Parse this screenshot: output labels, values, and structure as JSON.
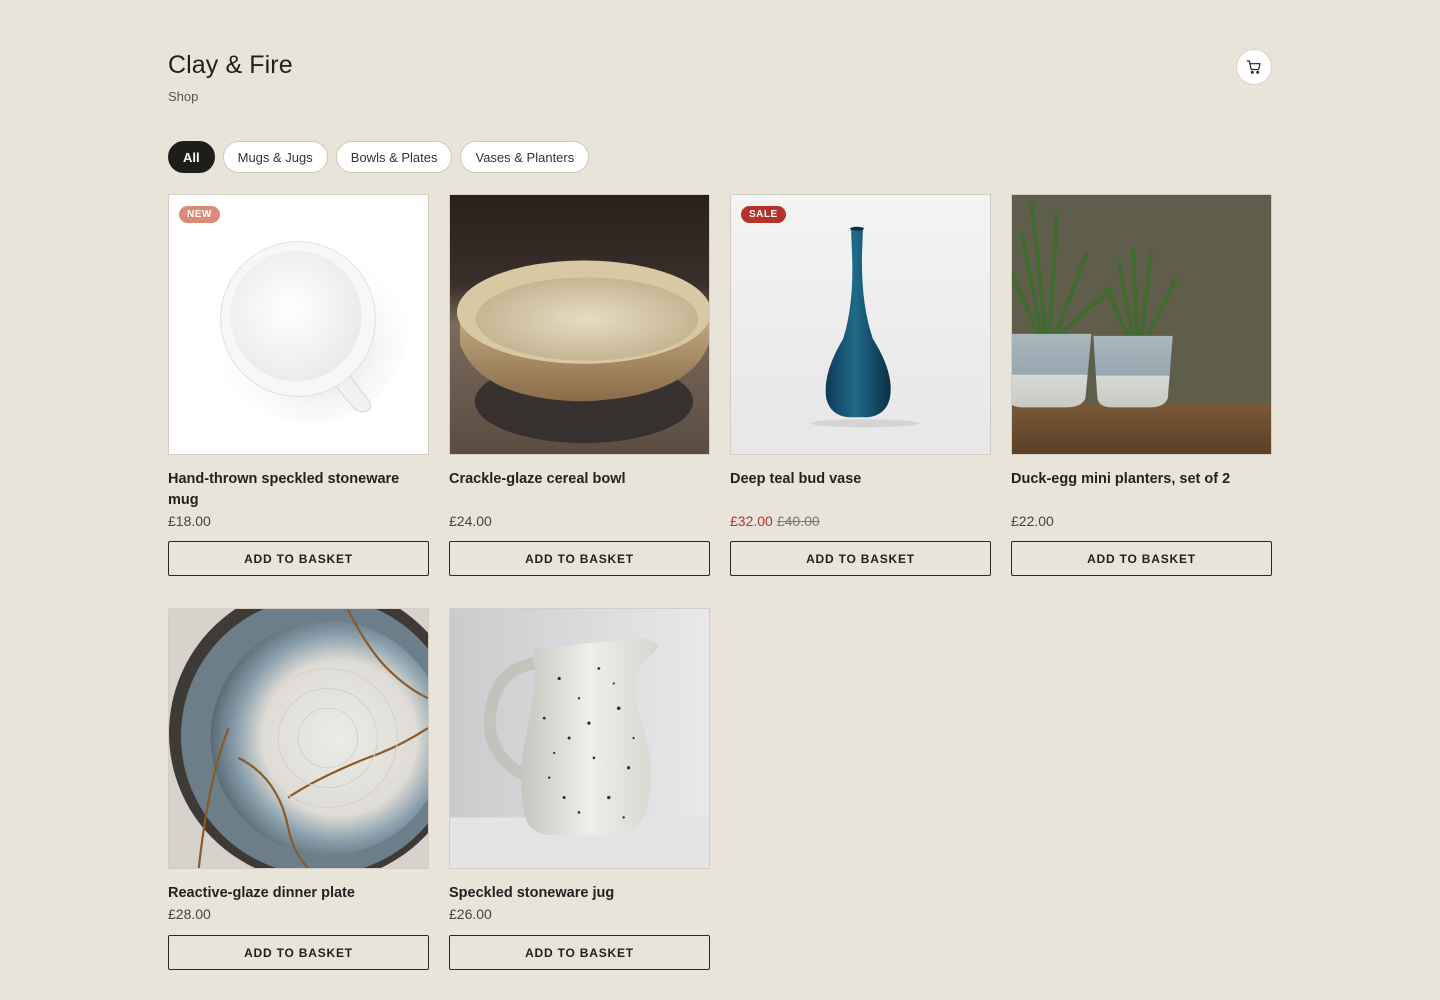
{
  "header": {
    "brand": "Clay & Fire",
    "subtitle": "Shop",
    "cart_icon": "cart-icon"
  },
  "filters": [
    "All",
    "Mugs & Jugs",
    "Bowls & Plates",
    "Vases & Planters"
  ],
  "active_filter": "All",
  "add_label": "ADD TO BASKET",
  "colors": {
    "background": "#e8e4da",
    "sale_red": "#b5322a",
    "new_badge": "#d98b78",
    "dark": "#1f1d1a"
  },
  "products": [
    {
      "name": "Hand-thrown speckled stoneware mug",
      "price": "£18.00",
      "badge": "NEW",
      "image": "white-mug-top-view"
    },
    {
      "name": "Crackle-glaze cereal bowl",
      "price": "£24.00",
      "image": "cream-bowl"
    },
    {
      "name": "Deep teal bud vase",
      "price": "£32.00",
      "old_price": "£40.00",
      "badge": "SALE",
      "image": "teal-vase"
    },
    {
      "name": "Duck-egg mini planters, set of 2",
      "price": "£22.00",
      "image": "planters-with-plants"
    },
    {
      "name": "Reactive-glaze dinner plate",
      "price": "£28.00",
      "image": "glazed-plate"
    },
    {
      "name": "Speckled stoneware jug",
      "price": "£26.00",
      "image": "speckled-jug"
    }
  ]
}
